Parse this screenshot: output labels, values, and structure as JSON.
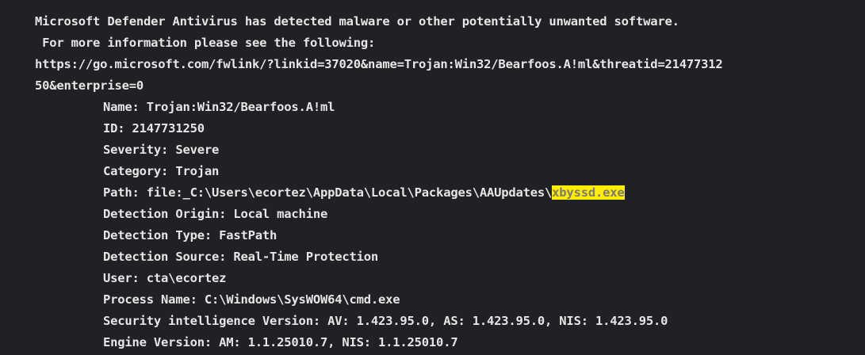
{
  "header": {
    "line1": "Microsoft Defender Antivirus has detected malware or other potentially unwanted software.",
    "line2": " For more information please see the following:",
    "url_part1": "https://go.microsoft.com/fwlink/?linkid=37020&name=Trojan:Win32/Bearfoos.A!ml&threatid=21477312",
    "url_part2": "50&enterprise=0"
  },
  "details": {
    "name": "Name: Trojan:Win32/Bearfoos.A!ml",
    "id": "ID: 2147731250",
    "severity": "Severity: Severe",
    "category": "Category: Trojan",
    "path_prefix": "Path: file:_C:\\Users\\ecortez\\AppData\\Local\\Packages\\AAUpdates\\",
    "path_highlight": "xbyssd.exe",
    "detection_origin": "Detection Origin: Local machine",
    "detection_type": "Detection Type: FastPath",
    "detection_source": "Detection Source: Real-Time Protection",
    "user": "User: cta\\ecortez",
    "process_name": "Process Name: C:\\Windows\\SysWOW64\\cmd.exe",
    "security_intelligence": "Security intelligence Version: AV: 1.423.95.0, AS: 1.423.95.0, NIS: 1.423.95.0",
    "engine_version": "Engine Version: AM: 1.1.25010.7, NIS: 1.1.25010.7"
  },
  "colors": {
    "background": "#202124",
    "text": "#e6e6e6",
    "highlight_bg": "#ffee00",
    "highlight_text": "#7a7a7a"
  }
}
